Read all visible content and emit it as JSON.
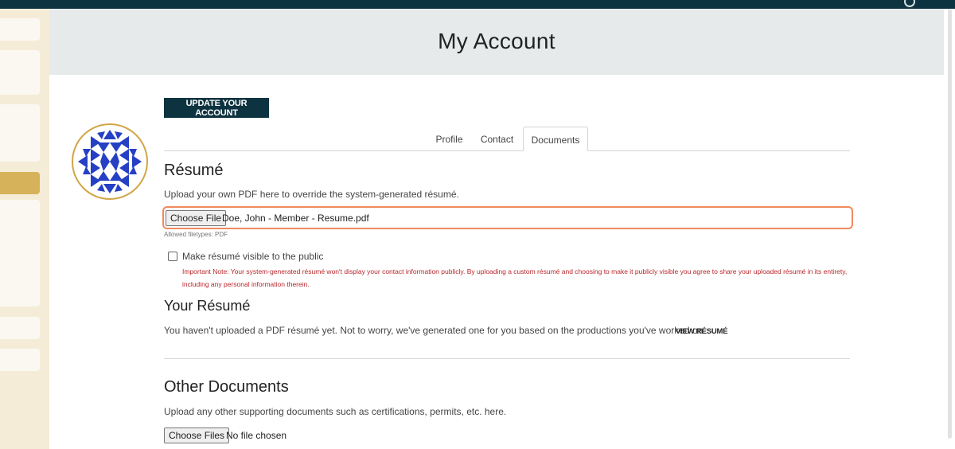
{
  "header": {
    "title": "My Account"
  },
  "account": {
    "update_button": "UPDATE YOUR ACCOUNT"
  },
  "tabs": [
    {
      "label": "Profile"
    },
    {
      "label": "Contact"
    },
    {
      "label": "Documents"
    }
  ],
  "resume": {
    "heading": "Résumé",
    "description": "Upload your own PDF here to override the system-generated résumé.",
    "file_button": "Choose File",
    "file_name": "Doe, John - Member - Resume.pdf",
    "allowed": "Allowed filetypes: PDF",
    "visibility_label": "Make résumé visible to the public",
    "important_note": "Important Note: Your system-generated résumé won't display your contact information publicly. By uploading a custom résumé and choosing to make it publicly visible you agree to share your uploaded résumé in its entirety, including any personal information therein."
  },
  "your_resume": {
    "heading": "Your Résumé",
    "text": "You haven't uploaded a PDF résumé yet. Not to worry, we've generated one for you based on the productions you've worked on.",
    "view_link": "VIEW RÉSUMÉ"
  },
  "other_documents": {
    "heading": "Other Documents",
    "description": "Upload any other supporting documents such as certifications, permits, etc. here.",
    "file_button": "Choose Files",
    "file_status": "No file chosen"
  },
  "colors": {
    "brand_dark": "#0e3340",
    "accent_gold": "#d6b35a",
    "focus_orange": "#f08a5d",
    "warning_red": "#b8262b",
    "avatar_blue": "#2540c4"
  }
}
